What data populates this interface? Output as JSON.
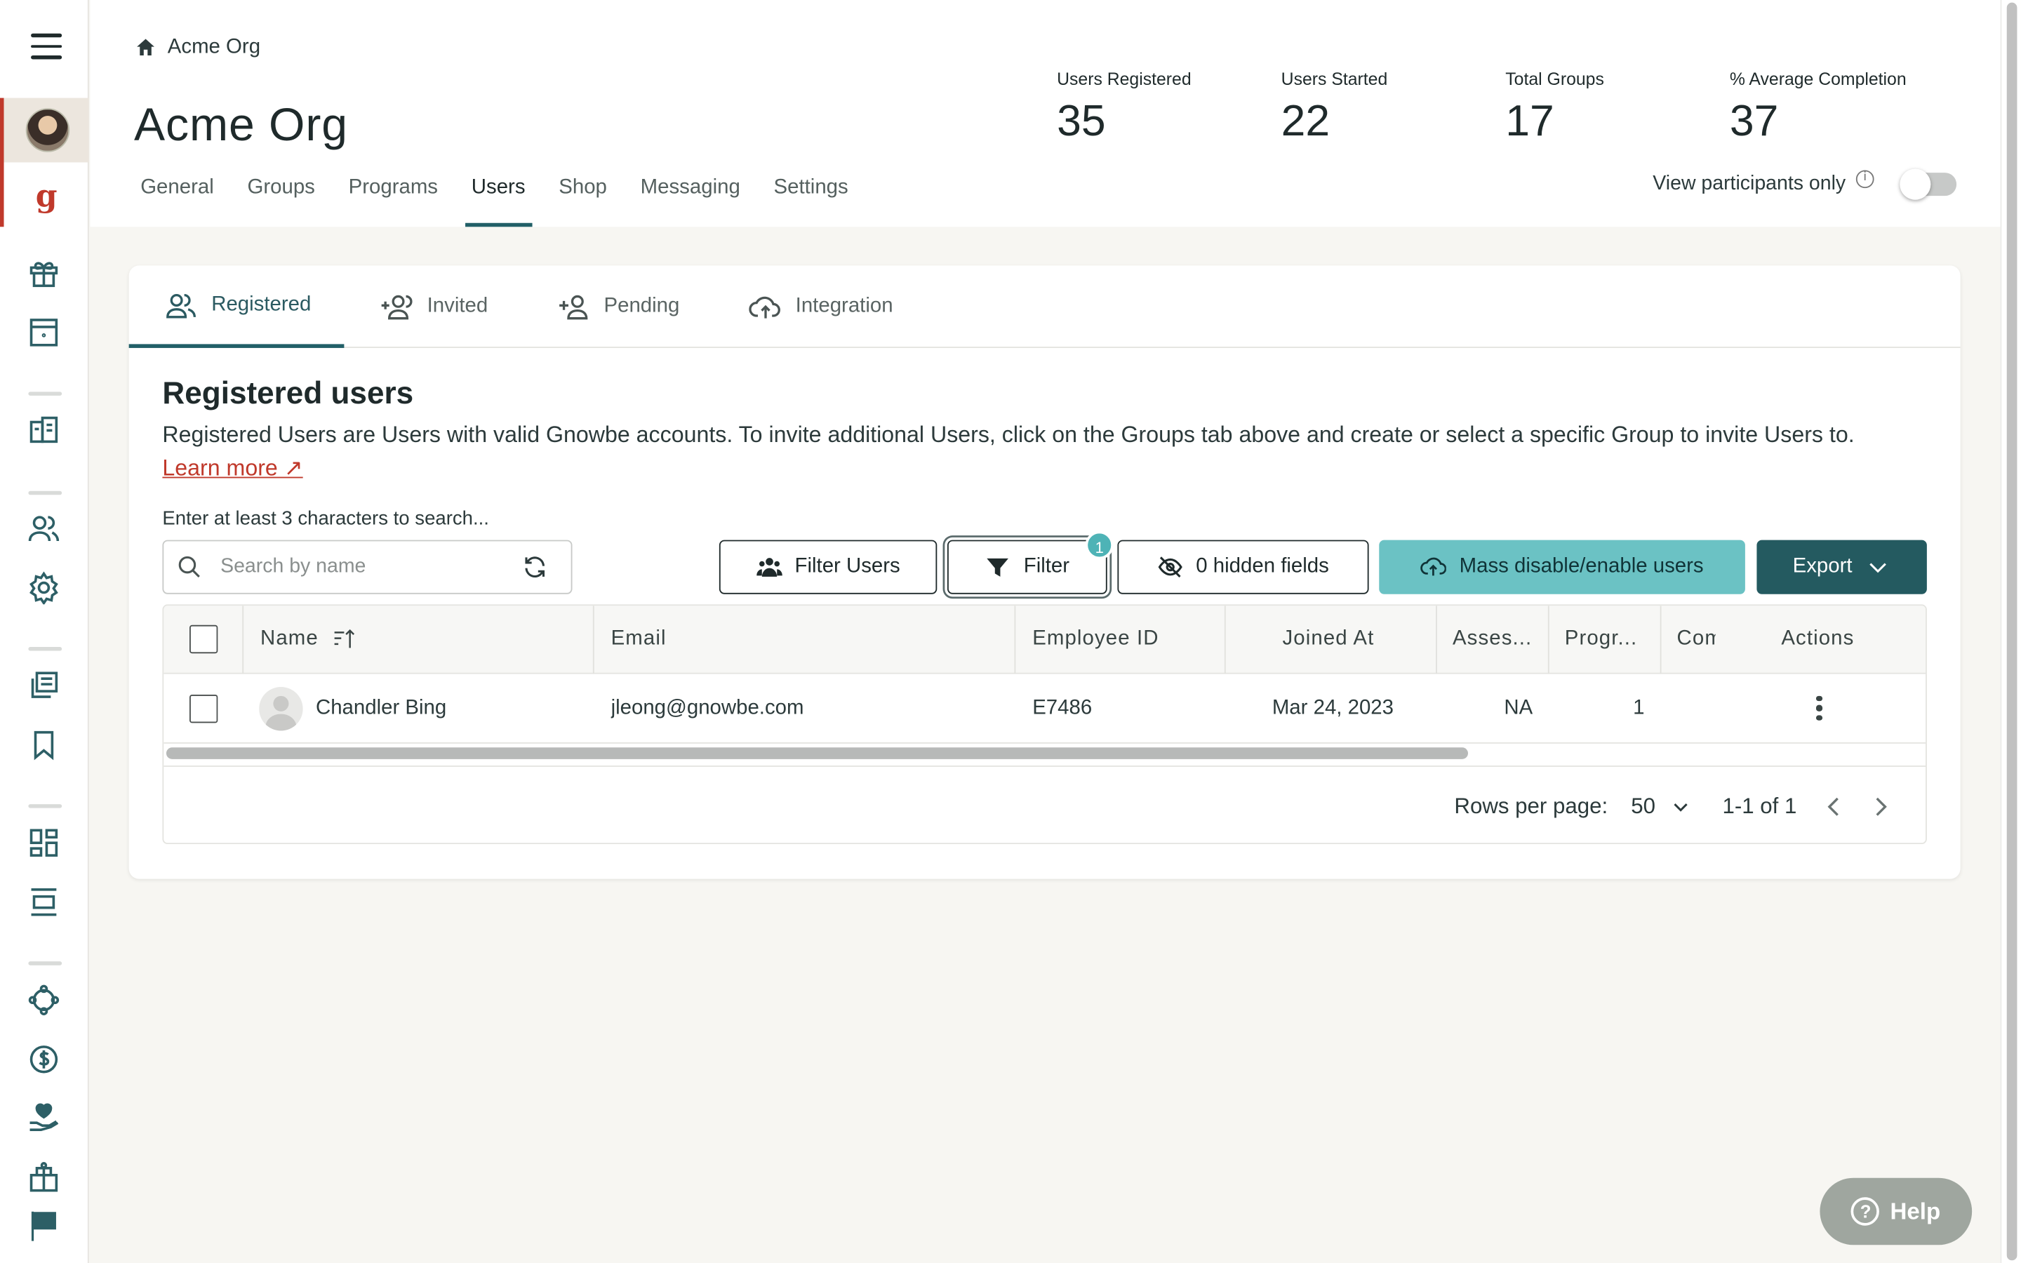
{
  "rail": {
    "icons": [
      "menu-icon",
      "gift-icon",
      "window-icon",
      "list-icon",
      "users-icon",
      "settings-icon",
      "library-icon",
      "bookmark-icon",
      "dashboard-icon",
      "layout-icon",
      "network-icon",
      "dollar-icon",
      "care-icon",
      "gift-box-icon",
      "flag-icon"
    ],
    "logo_letter": "g"
  },
  "header": {
    "breadcrumb": "Acme Org",
    "title": "Acme Org",
    "stats": [
      {
        "label": "Users Registered",
        "value": "35"
      },
      {
        "label": "Users Started",
        "value": "22"
      },
      {
        "label": "Total Groups",
        "value": "17"
      },
      {
        "label": "% Average Completion",
        "value": "37"
      }
    ],
    "tabs": [
      "General",
      "Groups",
      "Programs",
      "Users",
      "Shop",
      "Messaging",
      "Settings"
    ],
    "active_tab": "Users",
    "participants_label": "View participants only",
    "participants_toggle": false
  },
  "subtabs": [
    "Registered",
    "Invited",
    "Pending",
    "Integration"
  ],
  "section": {
    "title": "Registered users",
    "description": "Registered Users are Users with valid Gnowbe accounts. To invite additional Users, click on the Groups tab above and create or select a specific Group to invite Users to. ",
    "learn_more": "Learn more ↗",
    "search_hint": "Enter at least 3 characters to search...",
    "search_placeholder": "Search by name"
  },
  "toolbar": {
    "filter_users": "Filter Users",
    "filter": "Filter",
    "filter_badge": "1",
    "hidden_fields": "0 hidden fields",
    "mass": "Mass disable/enable users",
    "export": "Export"
  },
  "table": {
    "columns": [
      "Name",
      "Email",
      "Employee ID",
      "Joined At",
      "Asses...",
      "Progr...",
      "Com",
      "Actions"
    ],
    "rows": [
      {
        "name": "Chandler Bing",
        "email": "jleong@gnowbe.com",
        "employee_id": "E7486",
        "joined_at": "Mar 24, 2023",
        "assessment": "NA",
        "progress": "1",
        "completion": ""
      }
    ]
  },
  "pager": {
    "rows_per_page_label": "Rows per page:",
    "rows_per_page": "50",
    "range": "1-1 of 1"
  },
  "help": "Help",
  "colors": {
    "accent": "#245a60",
    "accent_light": "#6bc2c4",
    "brand_red": "#c0392b"
  }
}
